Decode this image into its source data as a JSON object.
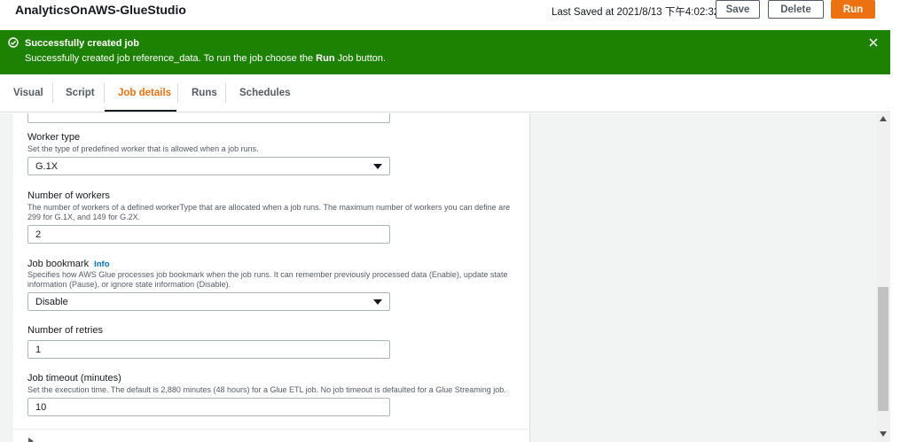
{
  "header": {
    "title": "AnalyticsOnAWS-GlueStudio",
    "last_saved": "Last Saved at 2021/8/13 下午4:02:32",
    "save_label": "Save",
    "delete_label": "Delete",
    "run_label": "Run"
  },
  "flash": {
    "title": "Successfully created job",
    "message_prefix": "Successfully created job reference_data. To run the job choose the ",
    "message_bold": "Run",
    "message_suffix": " Job button.",
    "color": "#1d8102"
  },
  "tabs": [
    {
      "label": "Visual"
    },
    {
      "label": "Script"
    },
    {
      "label": "Job details",
      "active": true
    },
    {
      "label": "Runs"
    },
    {
      "label": "Schedules"
    }
  ],
  "form": {
    "worker_type": {
      "label": "Worker type",
      "description": "Set the type of predefined worker that is allowed when a job runs.",
      "value": "G.1X"
    },
    "num_workers": {
      "label": "Number of workers",
      "description": "The number of workers of a defined workerType that are allocated when a job runs. The maximum number of workers you can define are 299 for G.1X, and 149 for G.2X.",
      "value": "2"
    },
    "job_bookmark": {
      "label": "Job bookmark",
      "info": "Info",
      "description": "Specifies how AWS Glue processes job bookmark when the job runs. It can remember previously processed data (Enable), update state information (Pause), or ignore state information (Disable).",
      "value": "Disable"
    },
    "num_retries": {
      "label": "Number of retries",
      "value": "1"
    },
    "job_timeout": {
      "label": "Job timeout (minutes)",
      "description": "Set the execution time. The default is 2,880 minutes (48 hours) for a Glue ETL job. No job timeout is defaulted for a Glue Streaming job.",
      "value": "10"
    }
  },
  "colors": {
    "accent": "#ec7211",
    "link": "#0073bb"
  }
}
